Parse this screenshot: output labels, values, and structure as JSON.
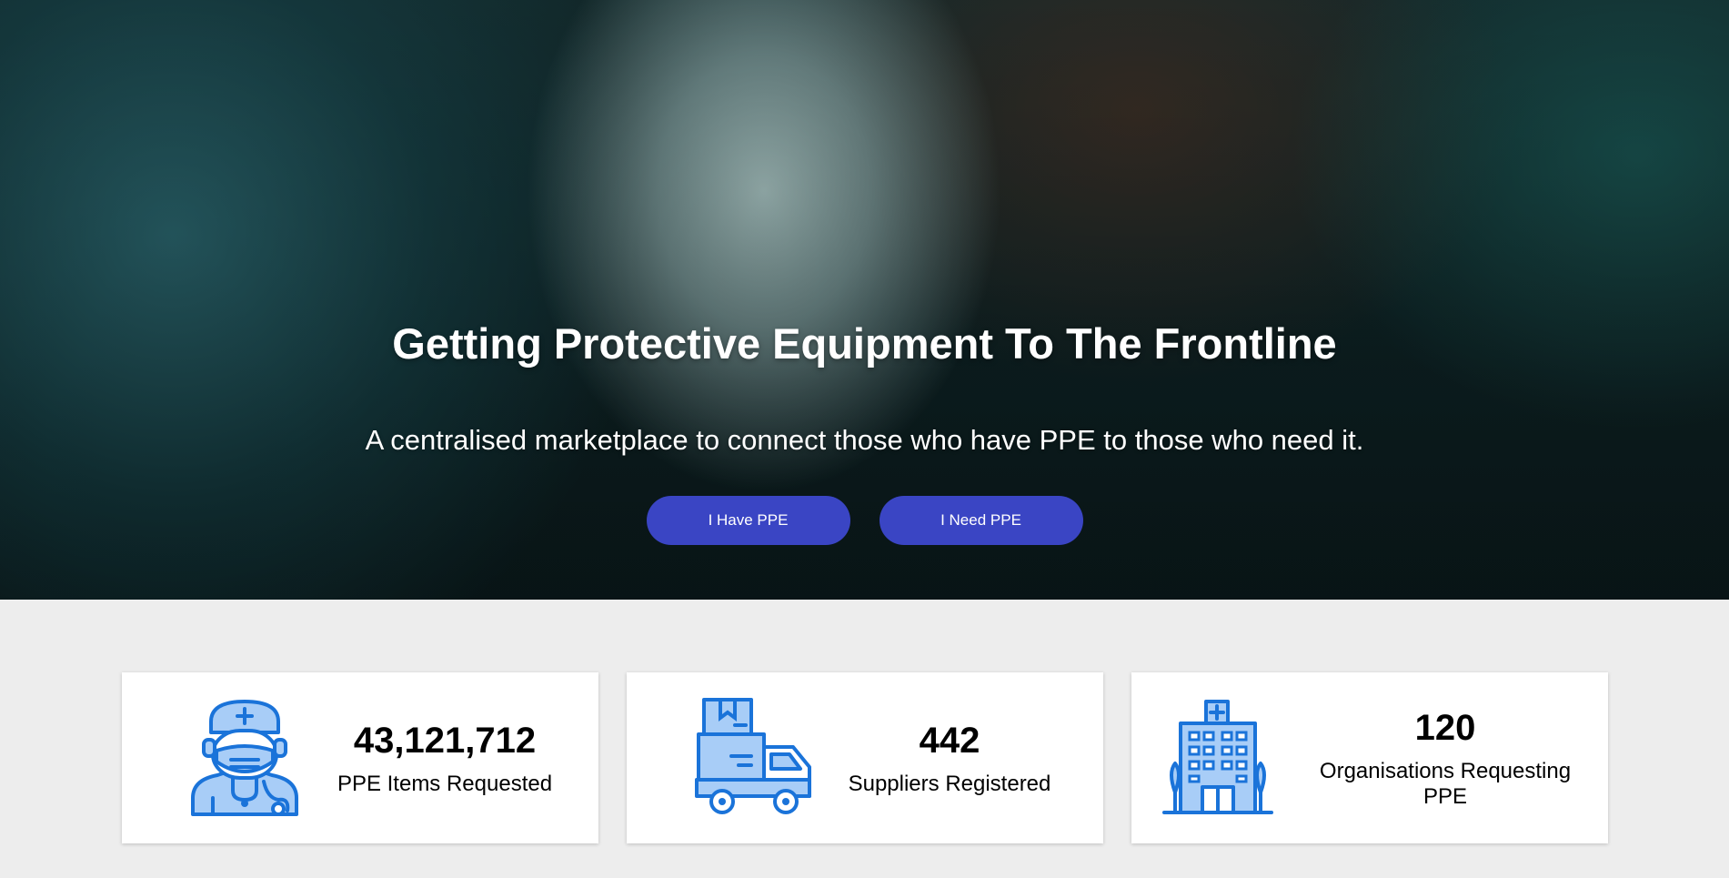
{
  "hero": {
    "title": "Getting Protective Equipment To The Frontline",
    "subtitle": "A centralised marketplace to connect those who have PPE to those who need it.",
    "buttons": {
      "have_ppe": "I Have PPE",
      "need_ppe": "I Need PPE"
    },
    "button_color": "#3a45c4"
  },
  "stats": [
    {
      "icon": "medical-worker-icon",
      "value": "43,121,712",
      "label": "PPE Items Requested"
    },
    {
      "icon": "delivery-truck-icon",
      "value": "442",
      "label": "Suppliers Registered"
    },
    {
      "icon": "hospital-icon",
      "value": "120",
      "label": "Organisations Requesting PPE"
    }
  ],
  "colors": {
    "icon_stroke": "#1a73d9",
    "icon_fill": "#a8cdf7",
    "page_background": "#ededed"
  }
}
